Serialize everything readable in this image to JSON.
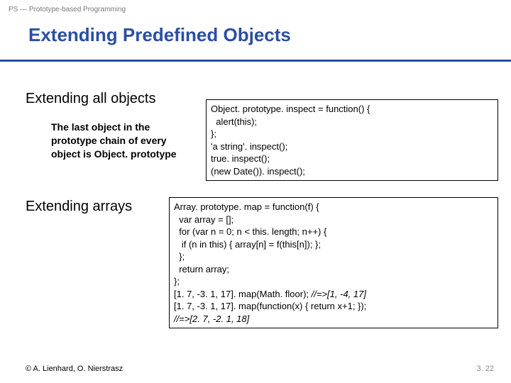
{
  "header_small": "PS — Prototype-based Programming",
  "title": "Extending Predefined Objects",
  "subhead1": "Extending all objects",
  "desc1": "The last object in the prototype chain of every object is Object. prototype",
  "code1_lines": [
    "Object. prototype. inspect = function() {",
    "  alert(this);",
    "};",
    "'a string'. inspect();",
    "true. inspect();",
    "(new Date()). inspect();"
  ],
  "subhead2": "Extending arrays",
  "code2_lines_a": [
    "Array. prototype. map = function(f) {",
    "  var array = [];",
    "  for (var n = 0; n < this. length; n++) {",
    "   if (n in this) { array[n] = f(this[n]); };",
    "  };",
    "  return array;",
    "};"
  ],
  "code2_line_b_prefix": "[1. 7, -3. 1, 17]. map(Math. floor); ",
  "code2_line_b_comment": "//=>[1, -4, 17]",
  "code2_line_c": "[1. 7, -3. 1, 17]. map(function(x) { return x+1; });",
  "code2_line_d": "//=>[2. 7, -2. 1, 18]",
  "footer_left": "© A. Lienhard, O. Nierstrasz",
  "footer_right": "3. 22"
}
